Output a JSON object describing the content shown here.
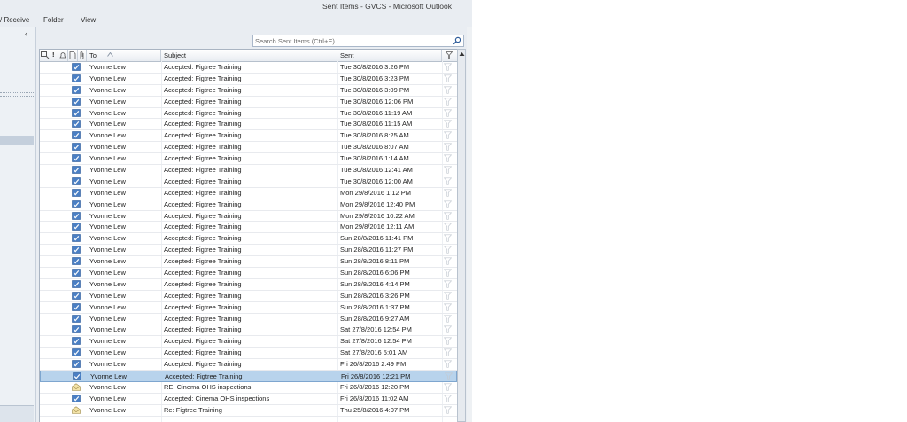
{
  "window": {
    "title": "Sent Items - GVCS  -  Microsoft Outlook"
  },
  "ribbon": {
    "tabs": [
      "/ Receive",
      "Folder",
      "View"
    ]
  },
  "search": {
    "placeholder": "Search Sent Items (Ctrl+E)",
    "value": ""
  },
  "columns": {
    "to": "To",
    "subject": "Subject",
    "sent": "Sent"
  },
  "rows": [
    {
      "to": "Yvonne Lew",
      "subject": "Accepted: Figtree Training",
      "sent": "Tue 30/8/2016 3:26 PM",
      "icon": "accepted-icon"
    },
    {
      "to": "Yvonne Lew",
      "subject": "Accepted: Figtree Training",
      "sent": "Tue 30/8/2016 3:23 PM",
      "icon": "accepted-icon"
    },
    {
      "to": "Yvonne Lew",
      "subject": "Accepted: Figtree Training",
      "sent": "Tue 30/8/2016 3:09 PM",
      "icon": "accepted-icon"
    },
    {
      "to": "Yvonne Lew",
      "subject": "Accepted: Figtree Training",
      "sent": "Tue 30/8/2016 12:06 PM",
      "icon": "accepted-icon"
    },
    {
      "to": "Yvonne Lew",
      "subject": "Accepted: Figtree Training",
      "sent": "Tue 30/8/2016 11:19 AM",
      "icon": "accepted-icon"
    },
    {
      "to": "Yvonne Lew",
      "subject": "Accepted: Figtree Training",
      "sent": "Tue 30/8/2016 11:15 AM",
      "icon": "accepted-icon"
    },
    {
      "to": "Yvonne Lew",
      "subject": "Accepted: Figtree Training",
      "sent": "Tue 30/8/2016 8:25 AM",
      "icon": "accepted-icon"
    },
    {
      "to": "Yvonne Lew",
      "subject": "Accepted: Figtree Training",
      "sent": "Tue 30/8/2016 8:07 AM",
      "icon": "accepted-icon"
    },
    {
      "to": "Yvonne Lew",
      "subject": "Accepted: Figtree Training",
      "sent": "Tue 30/8/2016 1:14 AM",
      "icon": "accepted-icon"
    },
    {
      "to": "Yvonne Lew",
      "subject": "Accepted: Figtree Training",
      "sent": "Tue 30/8/2016 12:41 AM",
      "icon": "accepted-icon"
    },
    {
      "to": "Yvonne Lew",
      "subject": "Accepted: Figtree Training",
      "sent": "Tue 30/8/2016 12:00 AM",
      "icon": "accepted-icon"
    },
    {
      "to": "Yvonne Lew",
      "subject": "Accepted: Figtree Training",
      "sent": "Mon 29/8/2016 1:12 PM",
      "icon": "accepted-icon"
    },
    {
      "to": "Yvonne Lew",
      "subject": "Accepted: Figtree Training",
      "sent": "Mon 29/8/2016 12:40 PM",
      "icon": "accepted-icon"
    },
    {
      "to": "Yvonne Lew",
      "subject": "Accepted: Figtree Training",
      "sent": "Mon 29/8/2016 10:22 AM",
      "icon": "accepted-icon"
    },
    {
      "to": "Yvonne Lew",
      "subject": "Accepted: Figtree Training",
      "sent": "Mon 29/8/2016 12:11 AM",
      "icon": "accepted-icon"
    },
    {
      "to": "Yvonne Lew",
      "subject": "Accepted: Figtree Training",
      "sent": "Sun 28/8/2016 11:41 PM",
      "icon": "accepted-icon"
    },
    {
      "to": "Yvonne Lew",
      "subject": "Accepted: Figtree Training",
      "sent": "Sun 28/8/2016 11:27 PM",
      "icon": "accepted-icon"
    },
    {
      "to": "Yvonne Lew",
      "subject": "Accepted: Figtree Training",
      "sent": "Sun 28/8/2016 8:11 PM",
      "icon": "accepted-icon"
    },
    {
      "to": "Yvonne Lew",
      "subject": "Accepted: Figtree Training",
      "sent": "Sun 28/8/2016 6:06 PM",
      "icon": "accepted-icon"
    },
    {
      "to": "Yvonne Lew",
      "subject": "Accepted: Figtree Training",
      "sent": "Sun 28/8/2016 4:14 PM",
      "icon": "accepted-icon"
    },
    {
      "to": "Yvonne Lew",
      "subject": "Accepted: Figtree Training",
      "sent": "Sun 28/8/2016 3:26 PM",
      "icon": "accepted-icon"
    },
    {
      "to": "Yvonne Lew",
      "subject": "Accepted: Figtree Training",
      "sent": "Sun 28/8/2016 1:37 PM",
      "icon": "accepted-icon"
    },
    {
      "to": "Yvonne Lew",
      "subject": "Accepted: Figtree Training",
      "sent": "Sun 28/8/2016 9:27 AM",
      "icon": "accepted-icon"
    },
    {
      "to": "Yvonne Lew",
      "subject": "Accepted: Figtree Training",
      "sent": "Sat 27/8/2016 12:54 PM",
      "icon": "accepted-icon"
    },
    {
      "to": "Yvonne Lew",
      "subject": "Accepted: Figtree Training",
      "sent": "Sat 27/8/2016 12:54 PM",
      "icon": "accepted-icon"
    },
    {
      "to": "Yvonne Lew",
      "subject": "Accepted: Figtree Training",
      "sent": "Sat 27/8/2016 5:01 AM",
      "icon": "accepted-icon"
    },
    {
      "to": "Yvonne Lew",
      "subject": "Accepted: Figtree Training",
      "sent": "Fri 26/8/2016 2:49 PM",
      "icon": "accepted-icon"
    },
    {
      "to": "Yvonne Lew",
      "subject": "Accepted: Figtree Training",
      "sent": "Fri 26/8/2016 12:21 PM",
      "icon": "accepted-icon",
      "selected": true
    },
    {
      "to": "Yvonne Lew",
      "subject": "RE: Cinema OHS inspections",
      "sent": "Fri 26/8/2016 12:20 PM",
      "icon": "open-envelope-icon"
    },
    {
      "to": "Yvonne Lew",
      "subject": "Accepted: Cinema OHS inspections",
      "sent": "Fri 26/8/2016 11:02 AM",
      "icon": "accepted-icon"
    },
    {
      "to": "Yvonne Lew",
      "subject": "Re: Figtree Training",
      "sent": "Thu 25/8/2016 4:07 PM",
      "icon": "open-envelope-icon"
    }
  ],
  "colors": {
    "selected_row": "#b8d3ec",
    "accepted_icon": "#3b6fb6",
    "chrome": "#e9edf2"
  }
}
